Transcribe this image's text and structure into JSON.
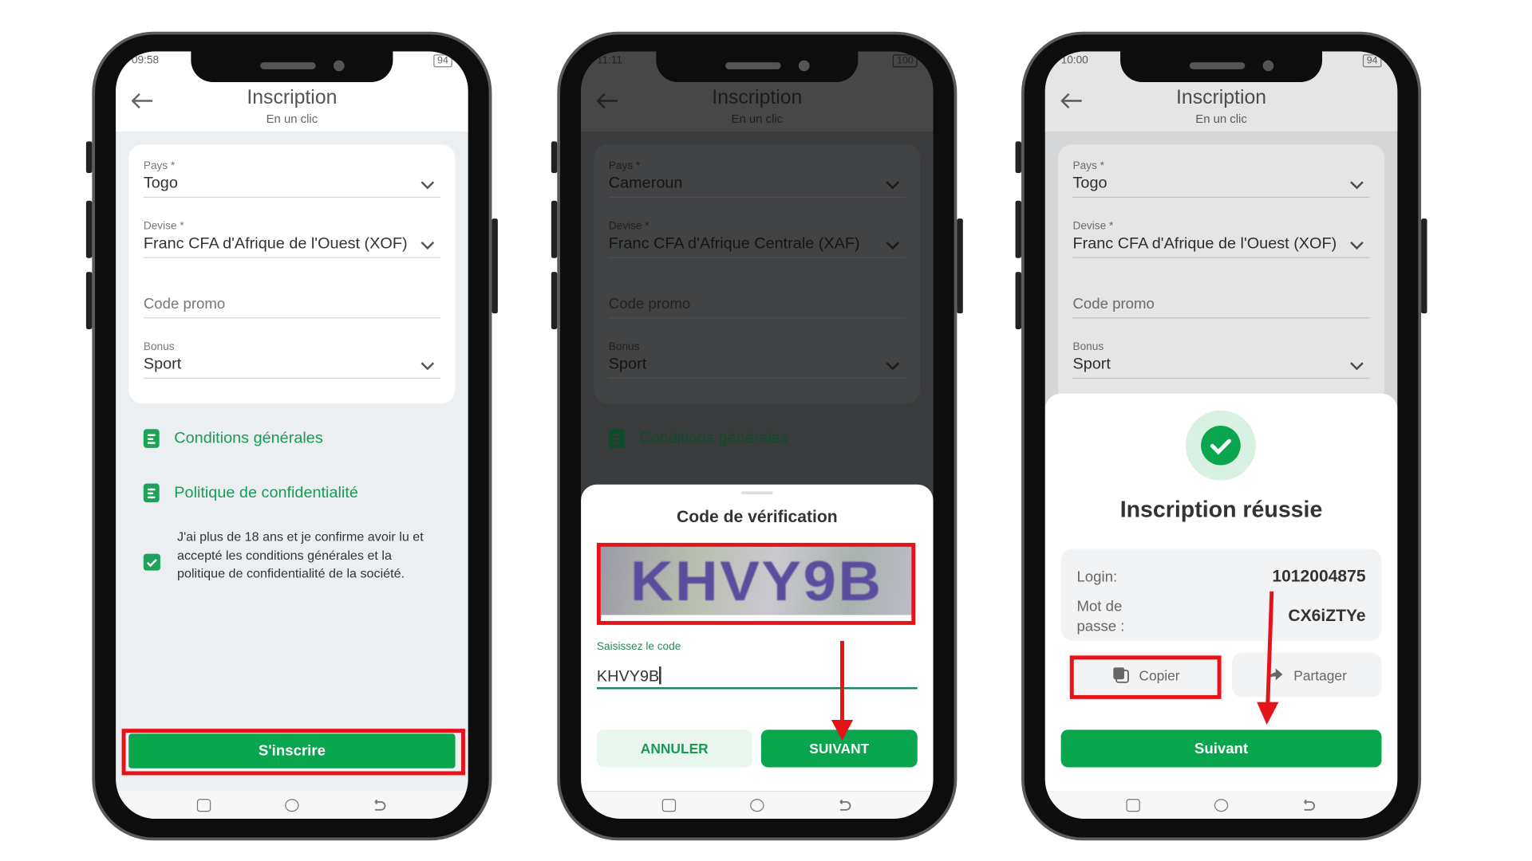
{
  "colors": {
    "brand_green": "#0aa64d",
    "annotation_red": "#e5141b",
    "link_green": "#1a9a55"
  },
  "phones": [
    {
      "status_time": "09:58",
      "battery": "94",
      "header": {
        "title": "Inscription",
        "subtitle": "En un clic"
      },
      "form": {
        "country_label": "Pays *",
        "country_value": "Togo",
        "currency_label": "Devise *",
        "currency_value": "Franc CFA d'Afrique de l'Ouest (XOF)",
        "promo_placeholder": "Code promo",
        "bonus_label": "Bonus",
        "bonus_value": "Sport"
      },
      "links": [
        "Conditions générales",
        "Politique de confidentialité"
      ],
      "consent_text": "J'ai plus de 18 ans et je confirme avoir lu et accepté les conditions générales et la politique de confidentialité de la société.",
      "consent_checked": true,
      "submit_label": "S'inscrire"
    },
    {
      "status_time": "11:11",
      "battery": "100",
      "header": {
        "title": "Inscription",
        "subtitle": "En un clic"
      },
      "form": {
        "country_label": "Pays *",
        "country_value": "Cameroun",
        "currency_label": "Devise *",
        "currency_value": "Franc CFA d'Afrique Centrale (XAF)",
        "promo_placeholder": "Code promo",
        "bonus_label": "Bonus",
        "bonus_value": "Sport"
      },
      "links": [
        "Conditions générales"
      ],
      "dialog": {
        "title": "Code de vérification",
        "captcha_text": "KHVY9B",
        "input_label": "Saisissez le code",
        "input_value": "KHVY9B",
        "cancel_label": "ANNULER",
        "next_label": "SUIVANT"
      }
    },
    {
      "status_time": "10:00",
      "battery": "94",
      "header": {
        "title": "Inscription",
        "subtitle": "En un clic"
      },
      "form": {
        "country_label": "Pays *",
        "country_value": "Togo",
        "currency_label": "Devise *",
        "currency_value": "Franc CFA d'Afrique de l'Ouest (XOF)",
        "promo_placeholder": "Code promo",
        "bonus_label": "Bonus",
        "bonus_value": "Sport"
      },
      "success": {
        "title": "Inscription réussie",
        "login_label": "Login:",
        "login_value": "1012004875",
        "password_label": "Mot de passe :",
        "password_value": "CX6iZTYe",
        "copy_label": "Copier",
        "share_label": "Partager",
        "next_label": "Suivant"
      }
    }
  ]
}
